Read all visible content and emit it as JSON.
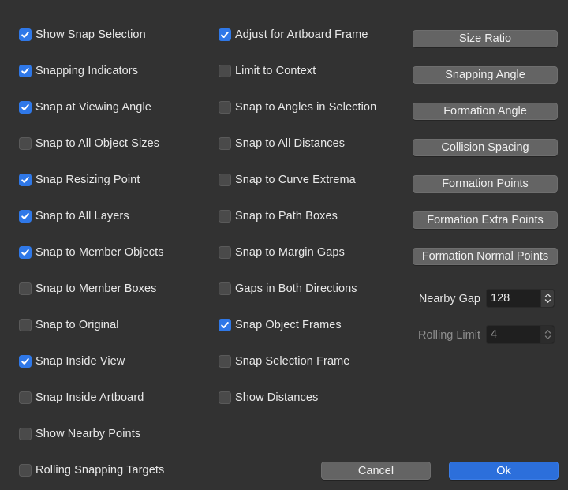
{
  "left_column": [
    {
      "label": "Show Snap Selection",
      "checked": true
    },
    {
      "label": "Snapping Indicators",
      "checked": true
    },
    {
      "label": "Snap at Viewing Angle",
      "checked": true
    },
    {
      "label": "Snap to All Object Sizes",
      "checked": false
    },
    {
      "label": "Snap Resizing Point",
      "checked": true
    },
    {
      "label": "Snap to All Layers",
      "checked": true
    },
    {
      "label": "Snap to Member Objects",
      "checked": true
    },
    {
      "label": "Snap to Member Boxes",
      "checked": false
    },
    {
      "label": "Snap to Original",
      "checked": false
    },
    {
      "label": "Snap Inside View",
      "checked": true
    },
    {
      "label": "Snap Inside Artboard",
      "checked": false
    },
    {
      "label": "Show Nearby Points",
      "checked": false
    },
    {
      "label": "Rolling Snapping Targets",
      "checked": false
    }
  ],
  "middle_column": [
    {
      "label": "Adjust for Artboard Frame",
      "checked": true
    },
    {
      "label": "Limit to Context",
      "checked": false
    },
    {
      "label": "Snap to Angles in Selection",
      "checked": false
    },
    {
      "label": "Snap to All Distances",
      "checked": false
    },
    {
      "label": "Snap to Curve Extrema",
      "checked": false
    },
    {
      "label": "Snap to Path Boxes",
      "checked": false
    },
    {
      "label": "Snap to Margin Gaps",
      "checked": false
    },
    {
      "label": "Gaps in Both Directions",
      "checked": false
    },
    {
      "label": "Snap Object Frames",
      "checked": true
    },
    {
      "label": "Snap Selection Frame",
      "checked": false
    },
    {
      "label": "Show Distances",
      "checked": false
    }
  ],
  "right_buttons": [
    {
      "label": "Size Ratio",
      "name": "size-ratio-button"
    },
    {
      "label": "Snapping Angle",
      "name": "snapping-angle-button"
    },
    {
      "label": "Formation Angle",
      "name": "formation-angle-button"
    },
    {
      "label": "Collision Spacing",
      "name": "collision-spacing-button"
    },
    {
      "label": "Formation Points",
      "name": "formation-points-button"
    },
    {
      "label": "Formation Extra Points",
      "name": "formation-extra-points-button"
    },
    {
      "label": "Formation Normal Points",
      "name": "formation-normal-points-button"
    }
  ],
  "nearby_gap": {
    "label": "Nearby Gap",
    "value": "128",
    "enabled": true
  },
  "rolling_limit": {
    "label": "Rolling Limit",
    "value": "4",
    "enabled": false
  },
  "footer": {
    "cancel_label": "Cancel",
    "ok_label": "Ok"
  },
  "colors": {
    "background": "#323232",
    "accent": "#2f78e8",
    "button": "#646464"
  }
}
